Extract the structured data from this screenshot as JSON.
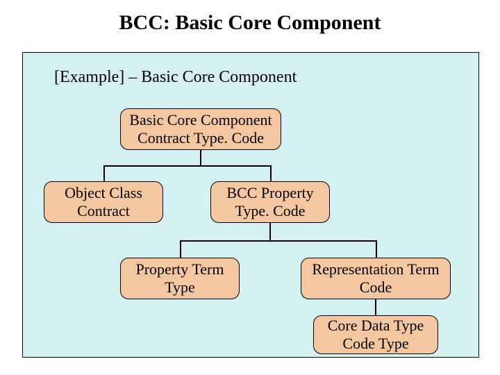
{
  "title": "BCC: Basic Core Component",
  "subtitle": "[Example] – Basic Core Component",
  "nodes": {
    "root": {
      "line1": "Basic Core Component",
      "line2": "Contract Type. Code"
    },
    "objectClass": {
      "line1": "Object Class",
      "line2": "Contract"
    },
    "bccProperty": {
      "line1": "BCC Property",
      "line2": "Type. Code"
    },
    "propertyTerm": {
      "line1": "Property Term",
      "line2": "Type"
    },
    "representationTerm": {
      "line1": "Representation Term",
      "line2": "Code"
    },
    "coreDataType": {
      "line1": "Core Data Type",
      "line2": "Code Type"
    }
  }
}
